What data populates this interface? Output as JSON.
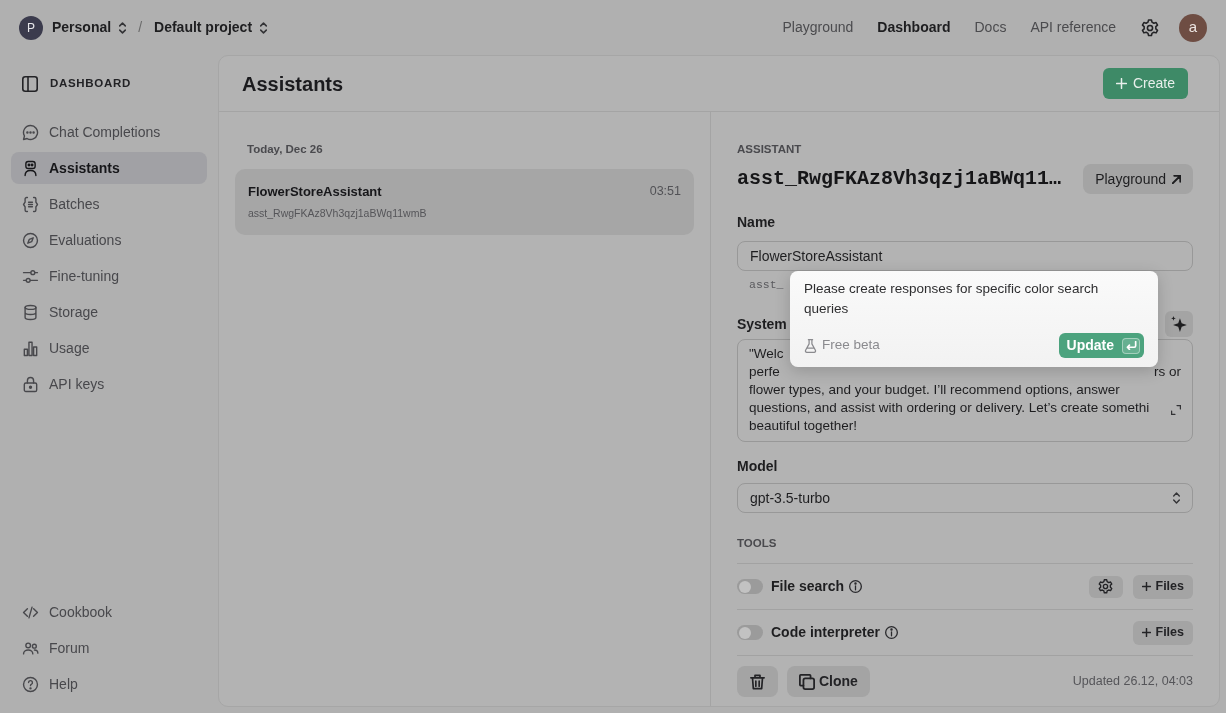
{
  "top_bar": {
    "organization": {
      "avatar_letter": "P",
      "name": "Personal"
    },
    "separator": "/",
    "project": {
      "name": "Default project"
    },
    "nav": [
      {
        "label": "Playground",
        "selected": false
      },
      {
        "label": "Dashboard",
        "selected": true
      },
      {
        "label": "Docs",
        "selected": false
      },
      {
        "label": "API reference",
        "selected": false
      }
    ],
    "user_avatar_letter": "a"
  },
  "sidebar": {
    "title": "DASHBOARD",
    "items": [
      {
        "label": "Chat Completions",
        "selected": false
      },
      {
        "label": "Assistants",
        "selected": true
      },
      {
        "label": "Batches",
        "selected": false
      },
      {
        "label": "Evaluations",
        "selected": false
      },
      {
        "label": "Fine-tuning",
        "selected": false
      },
      {
        "label": "Storage",
        "selected": false
      },
      {
        "label": "Usage",
        "selected": false
      },
      {
        "label": "API keys",
        "selected": false
      }
    ],
    "footer_items": [
      {
        "label": "Cookbook"
      },
      {
        "label": "Forum"
      },
      {
        "label": "Help"
      }
    ]
  },
  "main": {
    "title": "Assistants",
    "create_button": "Create",
    "list": {
      "group_label": "Today, Dec 26",
      "items": [
        {
          "name": "FlowerStoreAssistant",
          "time": "03:51",
          "id": "asst_RwgFKAz8Vh3qzj1aBWq11wmB",
          "selected": true
        }
      ]
    },
    "detail": {
      "section_label": "ASSISTANT",
      "id_heading": "asst_RwgFKAz8Vh3qzj1aBWq11…",
      "playground_button": "Playground",
      "name_label": "Name",
      "name_value": "FlowerStoreAssistant",
      "id_hint": "asst_",
      "instructions_label": "System",
      "instructions_lines": [
        [
          "\"Welc"
        ],
        [
          "perfe",
          "rs or"
        ],
        [
          "flower types, and your budget. I’ll recommend options, answer"
        ],
        [
          "questions, and assist with ordering or delivery. Let’s create somethi"
        ],
        [
          "beautiful together!"
        ]
      ],
      "model_label": "Model",
      "model_value": "gpt-3.5-turbo",
      "tools_label": "TOOLS",
      "tools": [
        {
          "label": "File search",
          "on": false,
          "settings_button": true,
          "files_button": "Files"
        },
        {
          "label": "Code interpreter",
          "on": false,
          "settings_button": false,
          "files_button": "Files"
        }
      ],
      "clone_button": "Clone",
      "updated": "Updated 26.12, 04:03"
    }
  },
  "prompt_popup": {
    "text": "Please create responses for specific color search queries",
    "beta_label": "Free beta",
    "update_button": "Update"
  }
}
